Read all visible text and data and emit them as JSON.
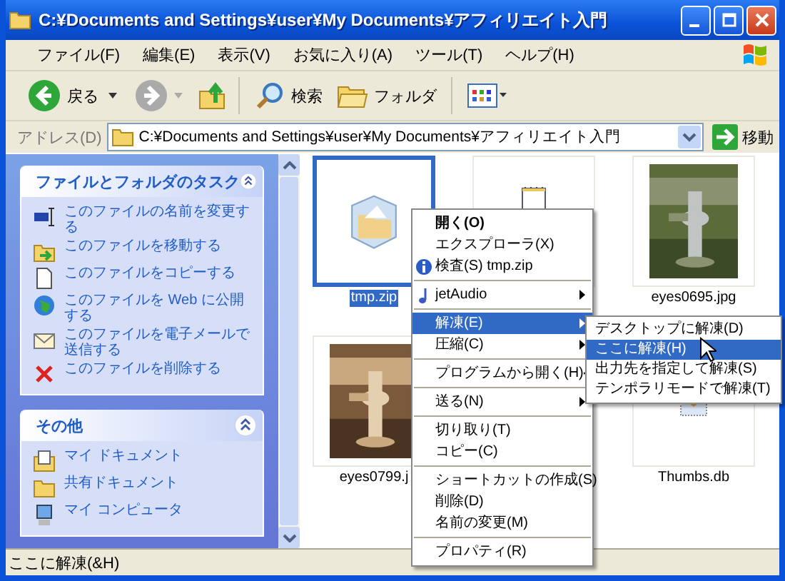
{
  "window": {
    "title": "C:¥Documents and Settings¥user¥My Documents¥アフィリエイト入門"
  },
  "menu_bar": [
    "ファイル(F)",
    "編集(E)",
    "表示(V)",
    "お気に入り(A)",
    "ツール(T)",
    "ヘルプ(H)"
  ],
  "toolbar": {
    "back": "戻る",
    "search": "検索",
    "folders": "フォルダ"
  },
  "address_bar": {
    "label": "アドレス(D)",
    "value": "C:¥Documents and Settings¥user¥My Documents¥アフィリエイト入門",
    "go": "移動"
  },
  "task_panels": [
    {
      "title": "ファイルとフォルダのタスク",
      "expanded": true,
      "items": [
        {
          "label": "このファイルの名前を変更する"
        },
        {
          "label": "このファイルを移動する"
        },
        {
          "label": "このファイルをコピーする"
        },
        {
          "label": "このファイルを Web に公開する"
        },
        {
          "label": "このファイルを電子メールで送信する"
        },
        {
          "label": "このファイルを削除する"
        }
      ]
    },
    {
      "title": "その他",
      "expanded": true,
      "items": [
        {
          "label": "マイ ドキュメント"
        },
        {
          "label": "共有ドキュメント"
        },
        {
          "label": "マイ コンピュータ"
        }
      ]
    }
  ],
  "files": [
    {
      "name": "tmp.zip",
      "kind": "zip",
      "selected": true
    },
    {
      "kind": "notepad",
      "selected": false
    },
    {
      "name": "eyes0695.jpg",
      "kind": "picture",
      "selected": false
    },
    {
      "name": "eyes0799.j",
      "kind": "picture",
      "selected": false
    },
    {
      "kind": "hidden"
    },
    {
      "name": "Thumbs.db",
      "kind": "db",
      "selected": false
    }
  ],
  "context_menu": [
    {
      "kind": "item",
      "label": "開く(O)",
      "bold": true,
      "selected": false
    },
    {
      "kind": "item",
      "label": "エクスプローラ(X)",
      "bold": false,
      "selected": false
    },
    {
      "kind": "icon_item",
      "label": "検査(S) tmp.zip",
      "bold": false,
      "selected": false
    },
    {
      "kind": "separator"
    },
    {
      "kind": "audio_submenu",
      "label": "jetAudio",
      "bold": false,
      "selected": false
    },
    {
      "kind": "separator"
    },
    {
      "kind": "submenu",
      "label": "解凍(E)",
      "bold": false,
      "selected": true
    },
    {
      "kind": "submenu",
      "label": "圧縮(C)",
      "bold": false,
      "selected": false
    },
    {
      "kind": "separator"
    },
    {
      "kind": "submenu",
      "label": "プログラムから開く(H)",
      "bold": false,
      "selected": false
    },
    {
      "kind": "separator"
    },
    {
      "kind": "submenu",
      "label": "送る(N)",
      "bold": false,
      "selected": false
    },
    {
      "kind": "separator"
    },
    {
      "kind": "item",
      "label": "切り取り(T)",
      "bold": false,
      "selected": false
    },
    {
      "kind": "item",
      "label": "コピー(C)",
      "bold": false,
      "selected": false
    },
    {
      "kind": "separator"
    },
    {
      "kind": "item",
      "label": "ショートカットの作成(S)",
      "bold": false,
      "selected": false
    },
    {
      "kind": "item",
      "label": "削除(D)",
      "bold": false,
      "selected": false
    },
    {
      "kind": "item",
      "label": "名前の変更(M)",
      "bold": false,
      "selected": false
    },
    {
      "kind": "separator"
    },
    {
      "kind": "item",
      "label": "プロパティ(R)",
      "bold": false,
      "selected": false
    }
  ],
  "submenu": [
    {
      "label": "デスクトップに解凍(D)",
      "selected": false
    },
    {
      "label": "ここに解凍(H)",
      "selected": true
    },
    {
      "label": "出力先を指定して解凍(S)",
      "selected": false
    },
    {
      "label": "テンポラリモードで解凍(T)",
      "selected": false
    }
  ],
  "status_bar": "ここに解凍(&H)"
}
